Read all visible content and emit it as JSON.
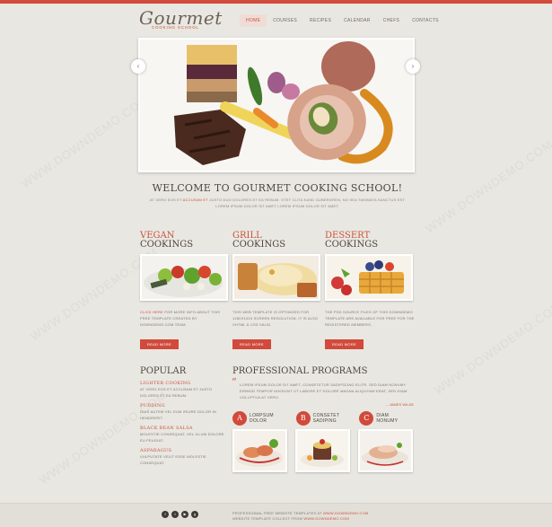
{
  "logo": {
    "main": "Gourmet",
    "sub": "COOKING SCHOOL"
  },
  "nav": [
    {
      "label": "HOME",
      "active": true
    },
    {
      "label": "COURSES",
      "active": false
    },
    {
      "label": "RECIPES",
      "active": false
    },
    {
      "label": "CALENDAR",
      "active": false
    },
    {
      "label": "CHEFS",
      "active": false
    },
    {
      "label": "CONTACTS",
      "active": false
    }
  ],
  "slider": {
    "prev": "‹",
    "next": "›"
  },
  "welcome": {
    "title": "WELCOME TO GOURMET COOKING SCHOOL!",
    "text_pre": "AT VERO EOS ET ",
    "text_hl": "ACCUSAM ET",
    "text_post": " JUSTO DUO DOLORES ET EA REBUM. STET CLITA KASD GUBERGREN, NO SEA TAKIMATA SANCTUS EST LOREM IPSUM DOLOR SIT AMET LOREM IPSUM DOLOR SIT AMET."
  },
  "columns": [
    {
      "title1": "VEGAN",
      "title2": "COOKINGS",
      "text_hl": "CLICK HERE",
      "text": " FOR MORE INFO ABOUT THIS FREE TEMPLATE CREATED BY DOWNDEMO.COM TEAM.",
      "button": "READ MORE"
    },
    {
      "title1": "GRILL",
      "title2": "COOKINGS",
      "text_hl": "",
      "text": "THIS WEB TEMPLATE IS OPTIMIZED FOR 1280X1024 SCREEN RESOLUTION. IT IS ALSO XHTML & CSS VALID.",
      "button": "READ MORE"
    },
    {
      "title1": "DESSERT",
      "title2": "COOKINGS",
      "text_hl": "",
      "text": "THE PSD SOURCE FILES OF THIS DOWNDEMO TEMPLATE ARE AVAILABLE FOR FREE FOR THE REGISTERED MEMBERS.",
      "button": "READ MORE"
    }
  ],
  "popular": {
    "title": "POPULAR",
    "items": [
      {
        "name": "LIGHTER COOKING",
        "desc": "AT VERO EOS ET ACCUSAM ET JUSTO DOLORES ET EA REBUM."
      },
      {
        "name": "PUDDING",
        "desc": "DUIS AUTEM VEL EUM IRIURE DOLOR IN HENDRERIT."
      },
      {
        "name": "BLACK BEAN SALSA",
        "desc": "MOLESTIE CONSEQUAT, VEL ILLUM DOLORE EU FEUGIAT."
      },
      {
        "name": "ASPARAGUS",
        "desc": "VULPUTATE VELIT ESSE MOLESTIE CONSEQUAT."
      }
    ]
  },
  "programs": {
    "title": "PROFESSIONAL PROGRAMS",
    "quote": "LOREM IPSUM DOLOR SIT AMET, CONSETETUR SADIPSCING ELITR, SED DIAM NONUMY EIRMOD TEMPOR INVIDUNT UT LABORE ET DOLORE MAGNA ALIQUYAM ERAT, SED DIAM VOLUPTUA AT VERO.",
    "author": "– JAMES WILDE",
    "steps": [
      {
        "letter": "A",
        "l1": "LORPSUM",
        "l2": "DOLOR"
      },
      {
        "letter": "B",
        "l1": "CONSETET",
        "l2": "SADIPING"
      },
      {
        "letter": "C",
        "l1": "DIAM",
        "l2": "NONUMY"
      }
    ]
  },
  "footer": {
    "social": [
      "f",
      "t",
      "▶",
      "g"
    ],
    "line1_pre": "PROFESSIONAL FREE WEBSITE TEMPLATES AT ",
    "line1_hl": "WWW.DOWNDEMO.COM",
    "line2_pre": "WEBSITE TEMPLATE COLLECT FROM ",
    "line2_hl": "WWW.DOWNDEMO.COM"
  },
  "watermark": "WWW.DOWNDEMO.COM",
  "colors": {
    "accent": "#d14a3b",
    "bg": "#e9e7e1"
  }
}
